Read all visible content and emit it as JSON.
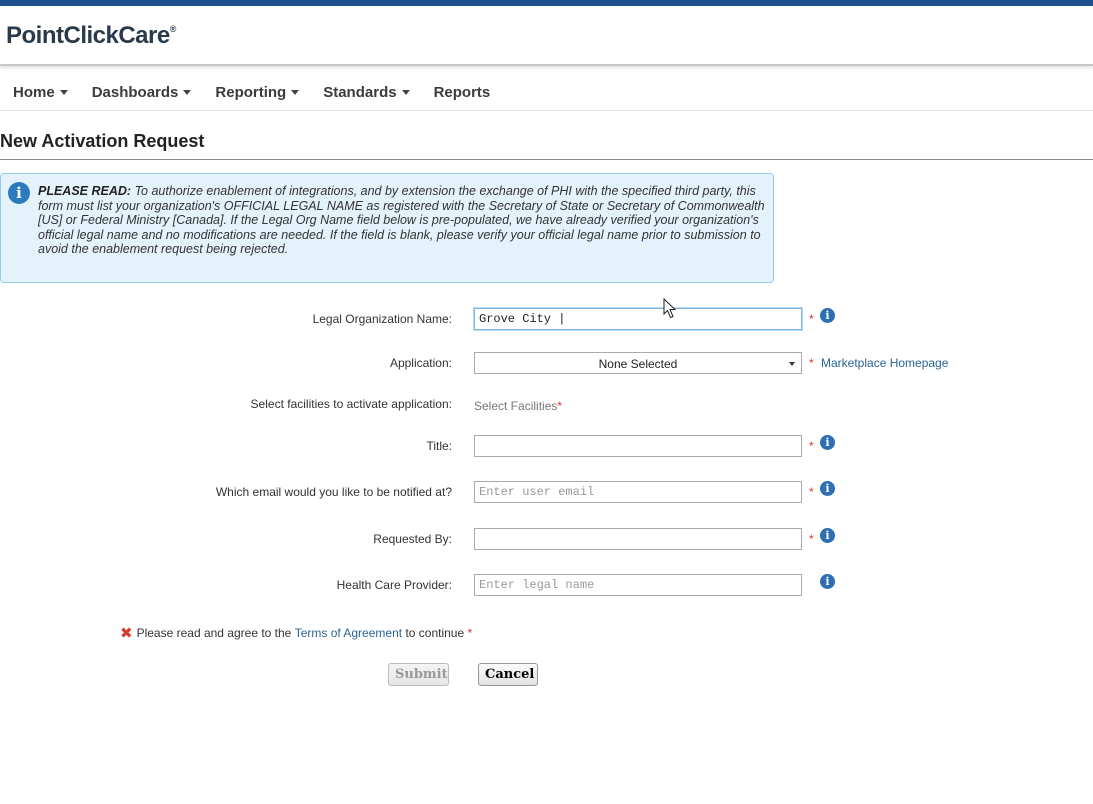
{
  "brand": {
    "name": "PointClickCare",
    "mark": "®"
  },
  "nav": {
    "items": [
      {
        "label": "Home",
        "dropdown": true
      },
      {
        "label": "Dashboards",
        "dropdown": true
      },
      {
        "label": "Reporting",
        "dropdown": true
      },
      {
        "label": "Standards",
        "dropdown": true
      },
      {
        "label": "Reports",
        "dropdown": false
      }
    ]
  },
  "page": {
    "title": "New Activation Request"
  },
  "notice": {
    "lead": "PLEASE READ:",
    "text": "To authorize enablement of integrations, and by extension the exchange of PHI with the specified third party, this form must list your organization's OFFICIAL LEGAL NAME as registered with the Secretary of State or Secretary of Commonwealth [US] or Federal Ministry [Canada]. If the Legal Org Name field below is pre-populated, we have already verified your organization's official legal name and no modifications are needed. If the field is blank, please verify your official legal name prior to submission to avoid the enablement request being rejected."
  },
  "form": {
    "legal_org": {
      "label": "Legal Organization Name:",
      "value": "Grove City |"
    },
    "application": {
      "label": "Application:",
      "selected": "None Selected",
      "link": "Marketplace Homepage"
    },
    "facilities": {
      "label": "Select facilities to activate application:",
      "value": "Select Facilities"
    },
    "title": {
      "label": "Title:",
      "value": ""
    },
    "email": {
      "label": "Which email would you like to be notified at?",
      "placeholder": "Enter user email"
    },
    "requested_by": {
      "label": "Requested By:",
      "value": ""
    },
    "provider": {
      "label": "Health Care Provider:",
      "placeholder": "Enter legal name"
    },
    "required_mark": "*",
    "info_glyph": "i"
  },
  "terms": {
    "prefix": "Please read and agree to the",
    "link": "Terms of Agreement",
    "suffix": "to continue"
  },
  "buttons": {
    "submit": "Submit",
    "cancel": "Cancel"
  },
  "colors": {
    "brand_bar": "#1f4f8f",
    "notice_bg": "#e4f2fb",
    "link": "#2a6496",
    "required": "#dd3333"
  }
}
